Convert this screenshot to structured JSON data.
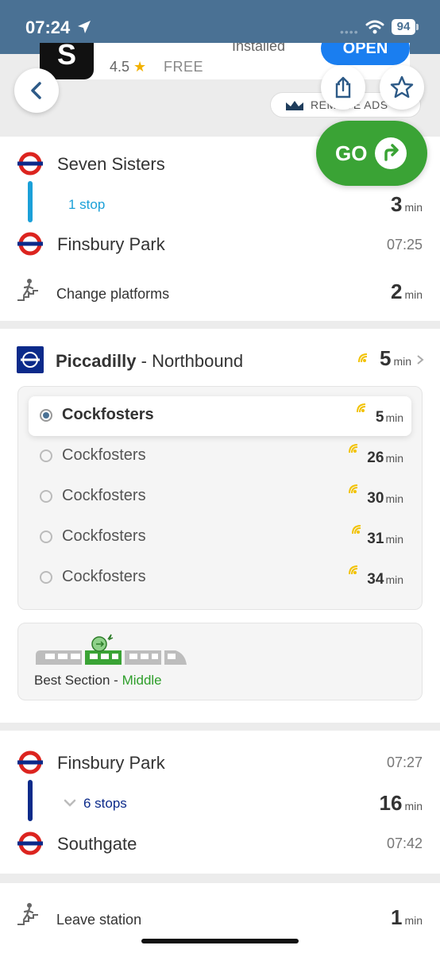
{
  "status_bar": {
    "time": "07:24",
    "battery": "94"
  },
  "ad": {
    "logo_letter": "S",
    "rating": "4.5",
    "star": "★",
    "price": "FREE",
    "installed": "Installed",
    "open_label": "OPEN"
  },
  "top_actions": {
    "remove_ads": "REMOVE ADS"
  },
  "go_button": {
    "label": "GO"
  },
  "leg1": {
    "from": "Seven Sisters",
    "stops": "1 stop",
    "duration": "3",
    "duration_unit": "min",
    "to": "Finsbury Park",
    "arrive_time": "07:25",
    "line_color": "#1ba0d8"
  },
  "change": {
    "label": "Change platforms",
    "duration": "2",
    "unit": "min"
  },
  "line": {
    "name": "Piccadilly",
    "direction": "- Northbound",
    "minutes": "5",
    "unit": "min",
    "color": "#0b2a8a"
  },
  "departures": [
    {
      "dest": "Cockfosters",
      "mins": "5",
      "unit": "min",
      "selected": true
    },
    {
      "dest": "Cockfosters",
      "mins": "26",
      "unit": "min",
      "selected": false
    },
    {
      "dest": "Cockfosters",
      "mins": "30",
      "unit": "min",
      "selected": false
    },
    {
      "dest": "Cockfosters",
      "mins": "31",
      "unit": "min",
      "selected": false
    },
    {
      "dest": "Cockfosters",
      "mins": "34",
      "unit": "min",
      "selected": false
    }
  ],
  "best_section": {
    "label": "Best Section - ",
    "value": "Middle"
  },
  "leg2": {
    "from": "Finsbury Park",
    "depart_time": "07:27",
    "stops": "6 stops",
    "duration": "16",
    "duration_unit": "min",
    "to": "Southgate",
    "arrive_time": "07:42",
    "line_color": "#0b2a8a"
  },
  "leave": {
    "label": "Leave station",
    "duration": "1",
    "unit": "min"
  },
  "colors": {
    "go_green": "#3aa335",
    "accent_green": "#2e9e2a",
    "realtime_yellow": "#f2c200",
    "header_blue": "#4a7194"
  }
}
